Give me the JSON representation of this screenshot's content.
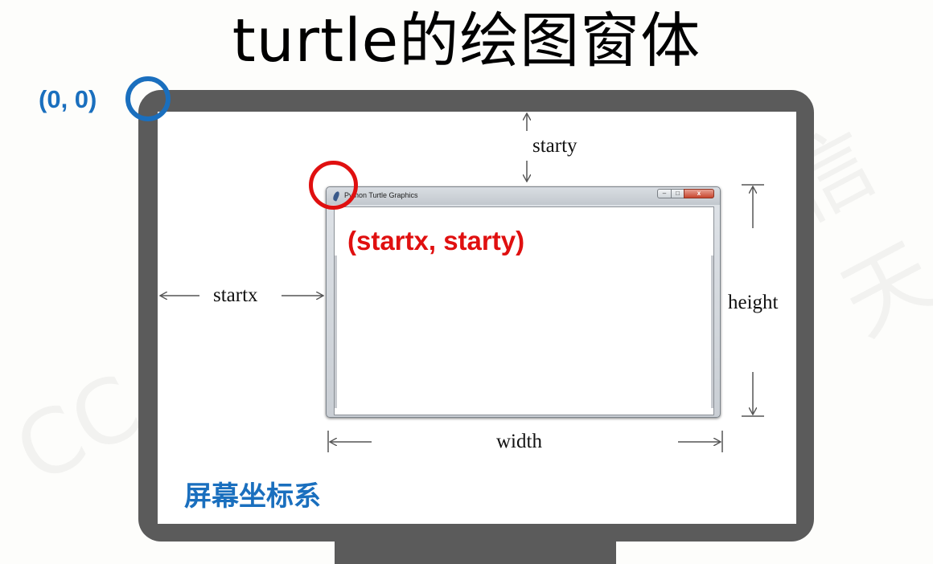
{
  "title": "turtle的绘图窗体",
  "origin_label": "(0, 0)",
  "window": {
    "title": "Python Turtle Graphics",
    "minimize_glyph": "–",
    "maximize_glyph": "□",
    "close_glyph": "x"
  },
  "start_coord_label": "(startx, starty)",
  "dimensions": {
    "starty": "starty",
    "startx": "startx",
    "height": "height",
    "width": "width"
  },
  "screen_coord_label": "屏幕坐标系",
  "watermarks": [
    "CC",
    "信天"
  ],
  "colors": {
    "frame": "#5b5b5b",
    "origin_blue": "#1a6fbe",
    "start_red": "#e01010"
  }
}
